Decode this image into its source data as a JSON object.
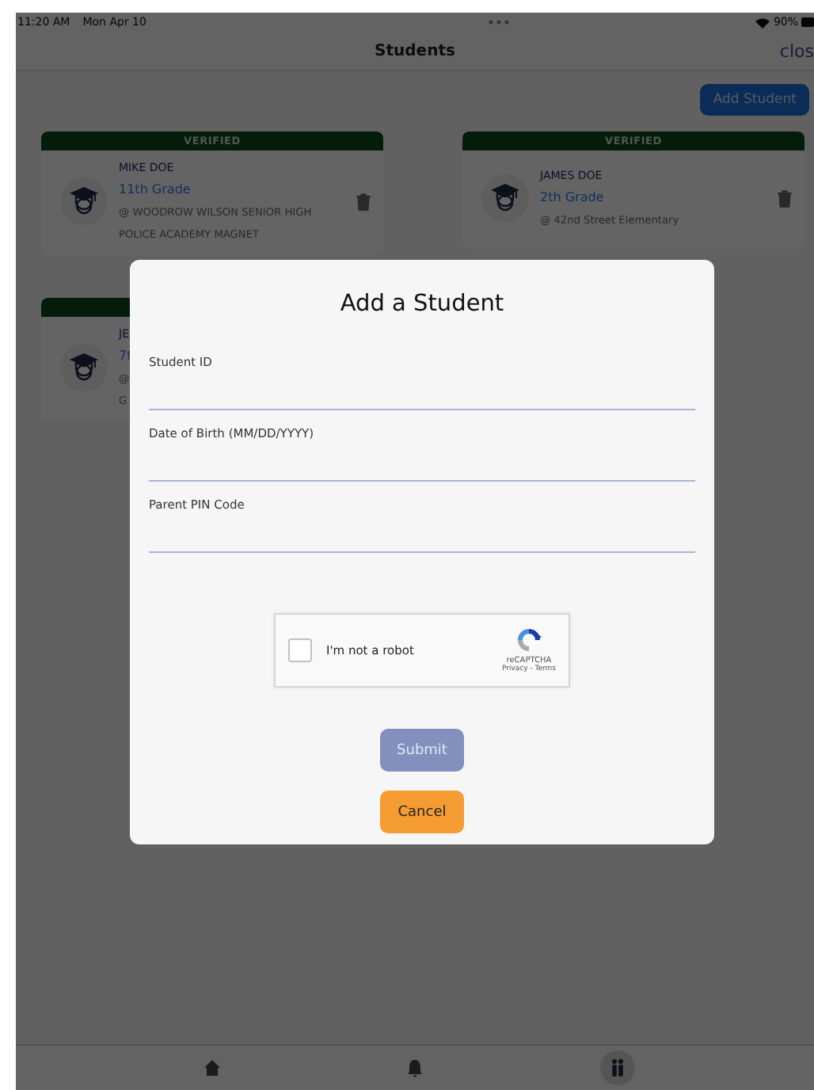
{
  "status_bar": {
    "time": "11:20 AM",
    "date": "Mon Apr 10",
    "battery": "90%"
  },
  "nav": {
    "title": "Students",
    "close": "clos"
  },
  "add_button": {
    "label": "Add Student"
  },
  "students": [
    {
      "status": "VERIFIED",
      "name": "MIKE DOE",
      "grade": "11th Grade",
      "school_lines": [
        "@ WOODROW WILSON SENIOR HIGH",
        "POLICE ACADEMY MAGNET"
      ]
    },
    {
      "status": "VERIFIED",
      "name": "JAMES DOE",
      "grade": "2th Grade",
      "school_lines": [
        "@ 42nd Street Elementary"
      ]
    },
    {
      "name": "JE",
      "grade": "7t",
      "school_lines": [
        "@",
        "G"
      ]
    }
  ],
  "dialog": {
    "title": "Add a Student",
    "fields": [
      {
        "label": "Student ID"
      },
      {
        "label": "Date of Birth (MM/DD/YYYY)"
      },
      {
        "label": "Parent PIN Code"
      }
    ],
    "captcha": {
      "label": "I'm not a robot",
      "checked": false,
      "brand": "reCAPTCHA",
      "links": "Privacy - Terms"
    },
    "buttons": [
      {
        "label": "Submit",
        "kind": "submit",
        "disabled": true
      },
      {
        "label": "Cancel",
        "kind": "cancel",
        "disabled": false
      }
    ]
  },
  "tab_bar": [
    {
      "kind": "home",
      "selected": false
    },
    {
      "kind": "bell",
      "selected": false
    },
    {
      "kind": "people",
      "selected": true
    }
  ]
}
